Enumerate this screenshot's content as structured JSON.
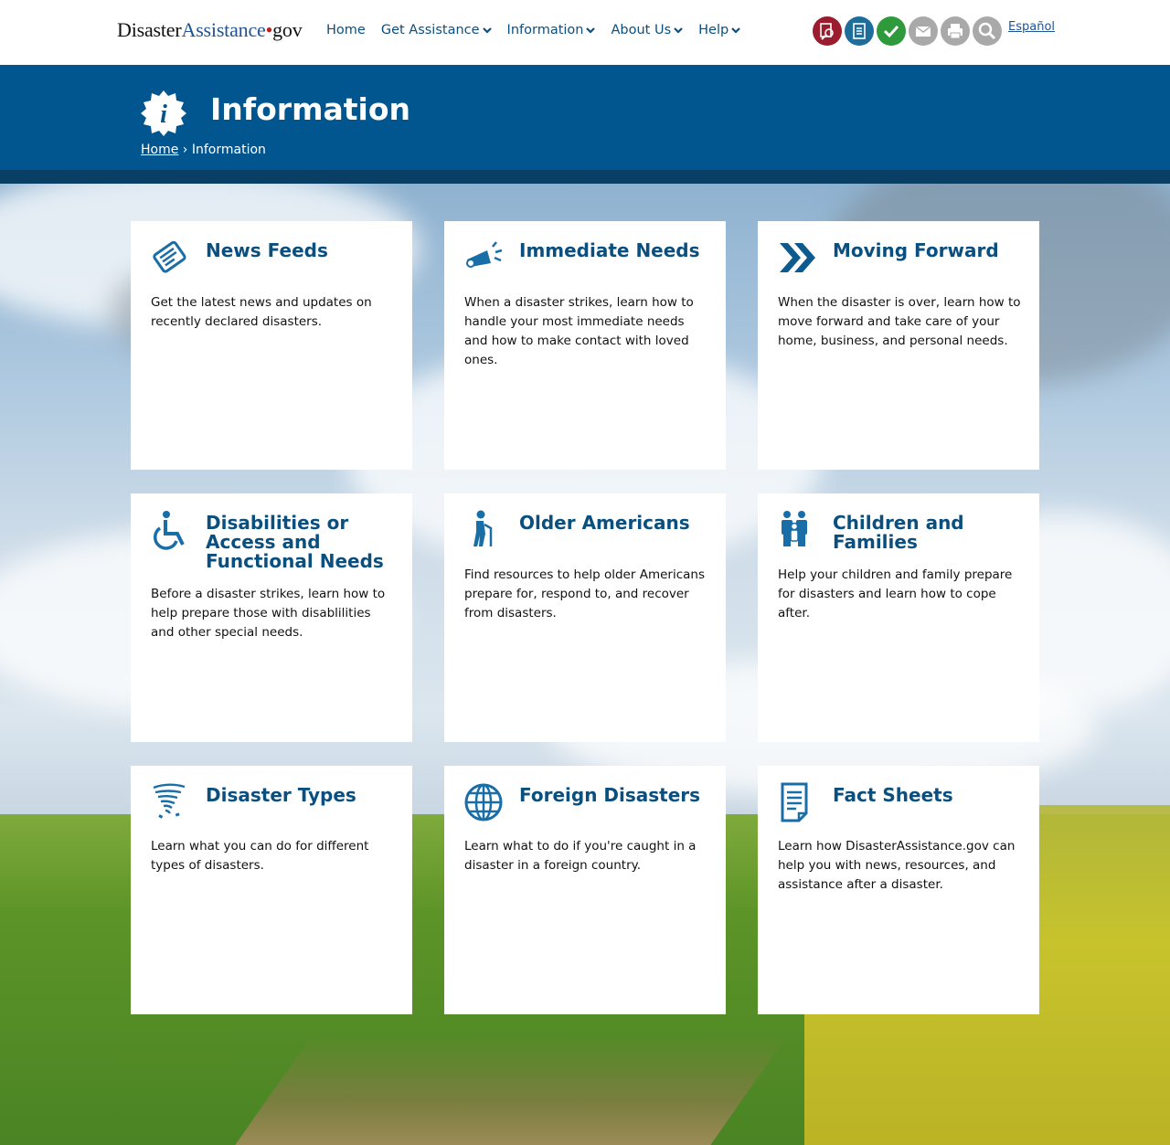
{
  "header": {
    "logo_part1": "Disaster",
    "logo_part2": "Assistance",
    "logo_dot": "•",
    "logo_part3": "gov",
    "nav": [
      {
        "label": "Home",
        "dropdown": false
      },
      {
        "label": "Get Assistance",
        "dropdown": true
      },
      {
        "label": "Information",
        "dropdown": true
      },
      {
        "label": "About Us",
        "dropdown": true
      },
      {
        "label": "Help",
        "dropdown": true
      }
    ],
    "tools": [
      {
        "icon": "apply-online-icon",
        "color": "#9b1c2e"
      },
      {
        "icon": "checklist-icon",
        "color": "#1f6d9b"
      },
      {
        "icon": "check-status-icon",
        "color": "#2e9a3b"
      },
      {
        "icon": "email-icon",
        "color": "#a9a9a9"
      },
      {
        "icon": "print-icon",
        "color": "#a9a9a9"
      },
      {
        "icon": "search-icon",
        "color": "#a9a9a9"
      }
    ],
    "language_link": "Español"
  },
  "banner": {
    "title": "Information",
    "icon": "info-badge-icon",
    "breadcrumb_home": "Home",
    "breadcrumb_sep": "›",
    "breadcrumb_current": "Information"
  },
  "cards": [
    {
      "title": "News Feeds",
      "icon": "newspaper-icon",
      "text": "Get the latest news and updates on recently declared disasters."
    },
    {
      "title": "Immediate Needs",
      "icon": "megaphone-icon",
      "text": "When a disaster strikes, learn how to handle your most immediate needs and how to make contact with loved ones."
    },
    {
      "title": "Moving Forward",
      "icon": "double-chevron-icon",
      "text": "When the disaster is over, learn how to move forward and take care of your home, business, and personal needs."
    },
    {
      "title": "Disabilities or Access and Functional Needs",
      "icon": "wheelchair-icon",
      "text": "Before a disaster strikes, learn how to help prepare those with disablilities and other special needs."
    },
    {
      "title": "Older Americans",
      "icon": "elder-cane-icon",
      "text": "Find resources to help older Americans prepare for, respond to, and recover from disasters."
    },
    {
      "title": "Children and Families",
      "icon": "family-icon",
      "text": "Help your children and family prepare for disasters and learn how to cope after."
    },
    {
      "title": "Disaster Types",
      "icon": "tornado-icon",
      "text": "Learn what you can do for different types of disasters."
    },
    {
      "title": "Foreign Disasters",
      "icon": "globe-icon",
      "text": "Learn what to do if you're caught in a disaster in a foreign country."
    },
    {
      "title": "Fact Sheets",
      "icon": "document-icon",
      "text": "Learn how DisasterAssistance.gov can help you with news, resources, and assistance after a disaster."
    }
  ]
}
